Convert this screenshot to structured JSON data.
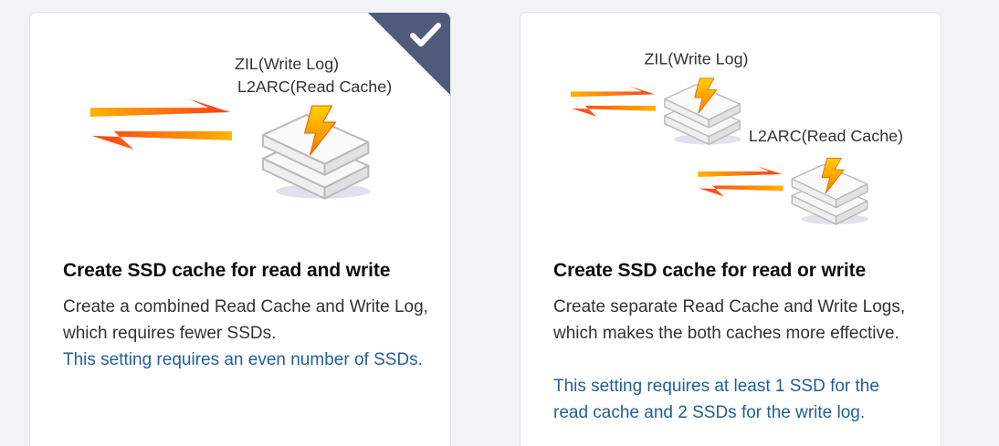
{
  "cards": [
    {
      "title": "Create SSD cache for read and write",
      "description": "Create a combined Read Cache and Write Log, which requires fewer SSDs.",
      "note": "This setting requires an even number of SSDs.",
      "selected": true,
      "labels": {
        "zil": "ZIL(Write Log)",
        "l2arc": "L2ARC(Read Cache)"
      }
    },
    {
      "title": "Create SSD cache for read or write",
      "description": "Create separate Read Cache and Write Logs, which makes the both caches more effective.",
      "note": "This setting requires at least 1 SSD for the read cache and 2 SSDs for the write log.",
      "selected": false,
      "labels": {
        "zil": "ZIL(Write Log)",
        "l2arc": "L2ARC(Read Cache)"
      }
    }
  ],
  "icons": {
    "selected_check": "check-icon",
    "arrows": "bidirectional-arrows-icon",
    "ssd": "ssd-stack-icon",
    "lightning": "lightning-icon"
  },
  "colors": {
    "background": "#f2f3f5",
    "card": "#ffffff",
    "selected_corner": "#505a7c",
    "note_text": "#1f5e9a",
    "arrow_orange": "#ff6a1a",
    "bolt": "#ff9a00"
  }
}
